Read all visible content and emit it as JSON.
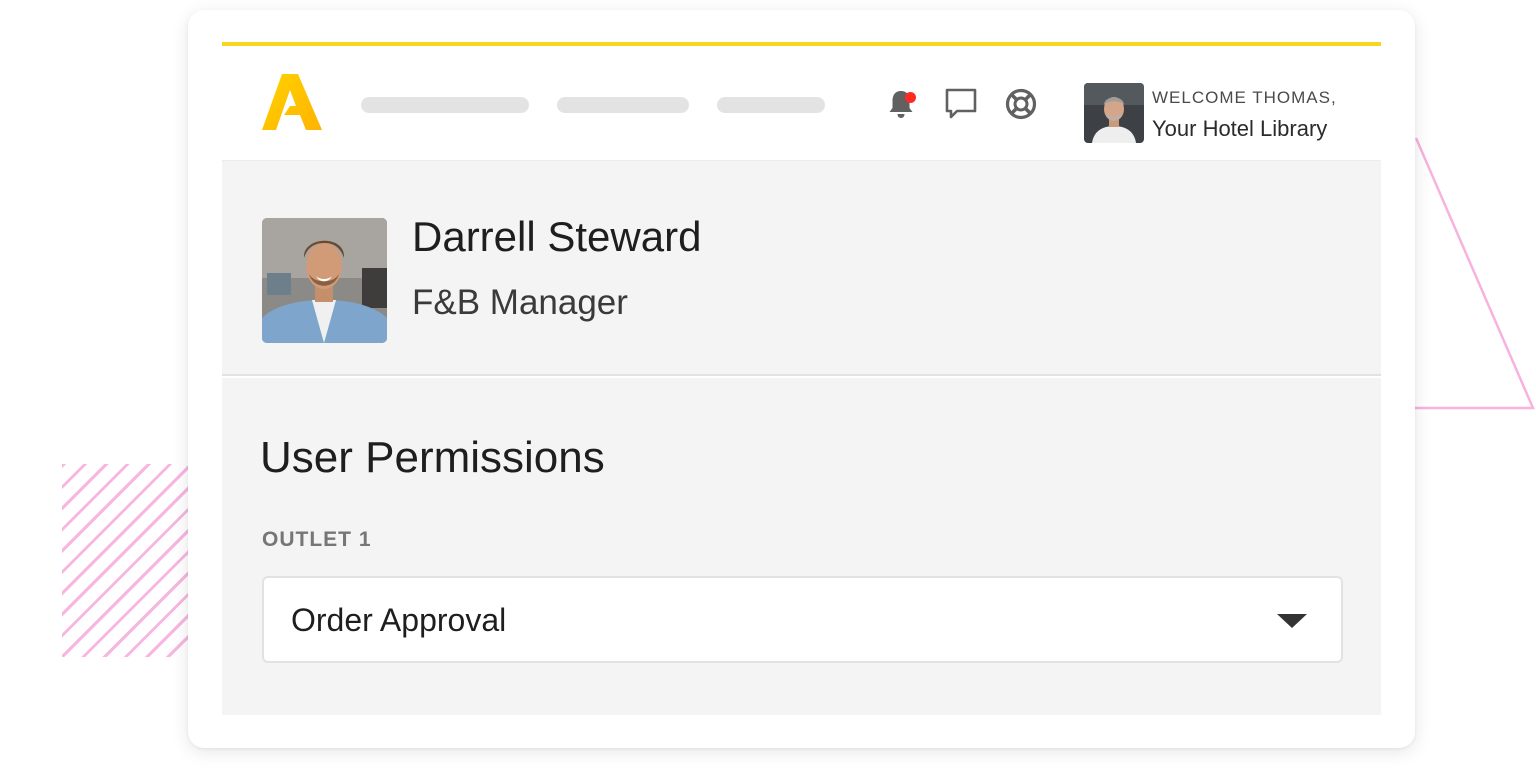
{
  "colors": {
    "accent": "#f7d71e",
    "logo": "#ffc400",
    "notification": "#ff2a24",
    "decoration": "#f7b2de"
  },
  "header": {
    "icons": [
      "bell-icon",
      "chat-icon",
      "help-lifebuoy-icon"
    ],
    "has_notification": true,
    "welcome_text": "WELCOME THOMAS,",
    "hotel_name": "Your Hotel Library"
  },
  "profile": {
    "name": "Darrell Steward",
    "role": "F&B Manager"
  },
  "permissions": {
    "title": "User Permissions",
    "outlet_label": "OUTLET 1",
    "selected_value": "Order Approval"
  }
}
